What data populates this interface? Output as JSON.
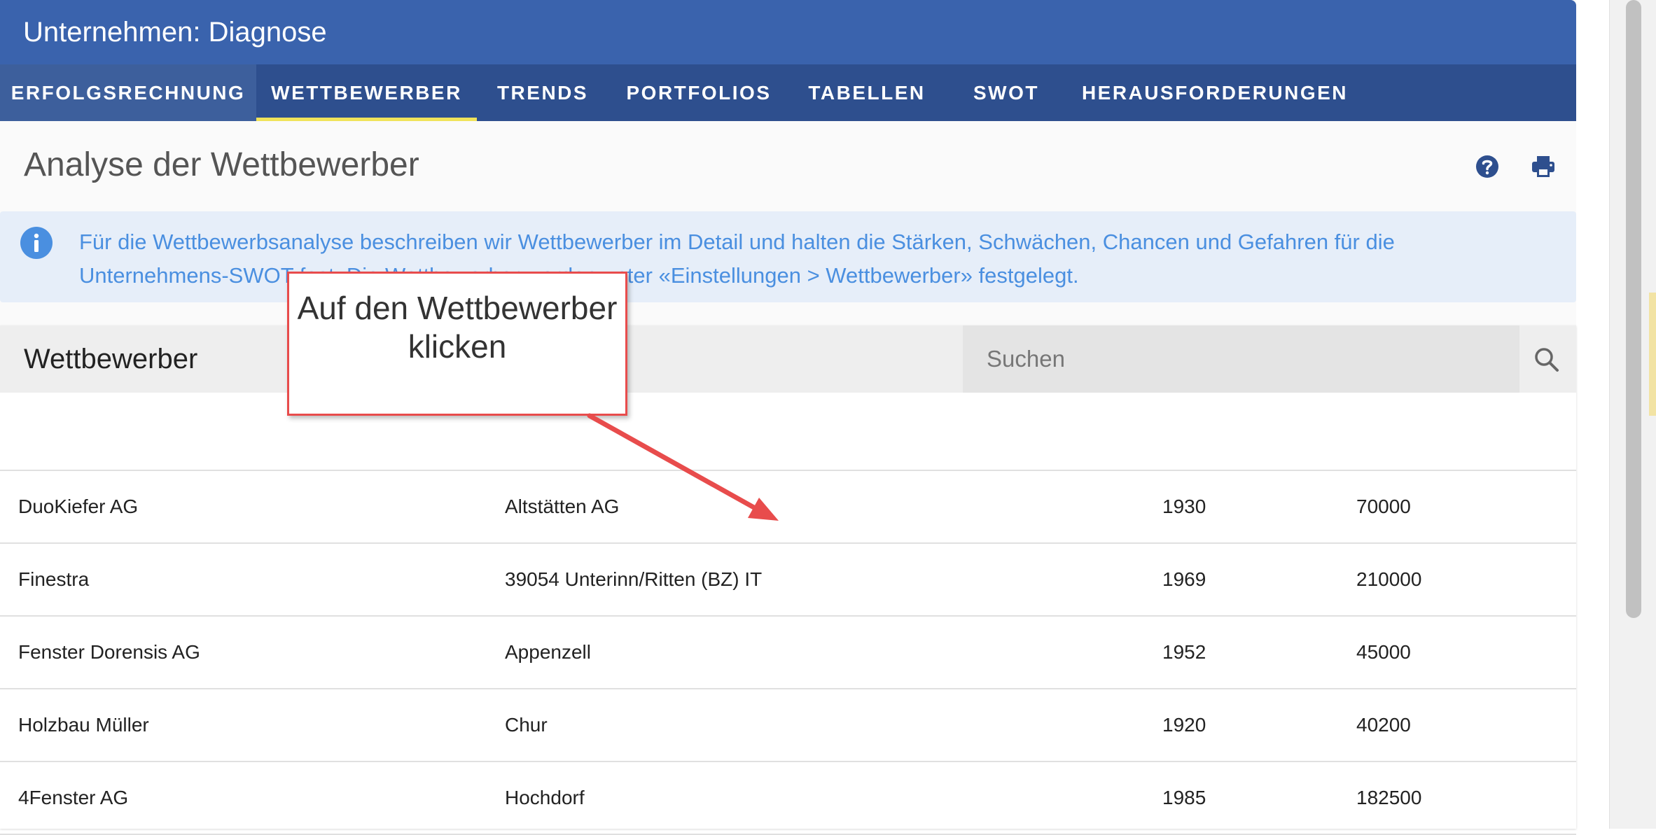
{
  "app": {
    "title": "Unternehmen: Diagnose"
  },
  "tabs": [
    {
      "label": "ERFOLGSRECHNUNG"
    },
    {
      "label": "WETTBEWERBER"
    },
    {
      "label": "TRENDS"
    },
    {
      "label": "PORTFOLIOS"
    },
    {
      "label": "TABELLEN"
    },
    {
      "label": "SWOT"
    },
    {
      "label": "HERAUSFORDERUNGEN"
    }
  ],
  "page": {
    "title": "Analyse der Wettbewerber"
  },
  "info": {
    "text": "Für die Wettbewerbsanalyse beschreiben wir Wettbewerber im Detail und halten die Stärken, Schwächen, Chancen und Gefahren für die Unternehmens-SWOT fest. Die Wettbewerber werden unter «Einstellungen > Wettbewerber» festgelegt."
  },
  "competitors": {
    "title": "Wettbewerber",
    "search_placeholder": "Suchen",
    "rows": [
      {
        "name": "DuoKiefer AG",
        "location": "Altstätten AG",
        "year": "1930",
        "value": "70000"
      },
      {
        "name": "Finestra",
        "location": "39054 Unterinn/Ritten (BZ) IT",
        "year": "1969",
        "value": "210000"
      },
      {
        "name": "Fenster Dorensis AG",
        "location": "Appenzell",
        "year": "1952",
        "value": "45000"
      },
      {
        "name": "Holzbau Müller",
        "location": "Chur",
        "year": "1920",
        "value": "40200"
      },
      {
        "name": "4Fenster AG",
        "location": "Hochdorf",
        "year": "1985",
        "value": "182500"
      }
    ]
  },
  "callout": {
    "text": "Auf den Wettbewerber klicken"
  },
  "icons": {
    "help": "help-icon",
    "print": "print-icon",
    "info": "info-icon",
    "search": "search-icon"
  },
  "colors": {
    "header_blue": "#3a63ad",
    "tab_bar": "#2e4f8e",
    "active_underline": "#f0e35a",
    "info_text": "#4a8fe0",
    "callout_red": "#e84c4c"
  }
}
